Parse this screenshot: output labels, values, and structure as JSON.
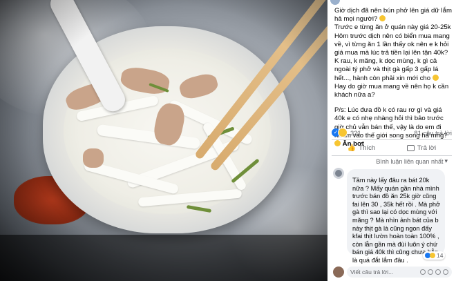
{
  "post": {
    "text_lines": [
      "Giờ dịch đã nên bún phở lên giá dữ lắm hả mọi người?",
      "Trước e từng ăn ở quán này giá 20-25k",
      "Hôm trước dịch nên có biển mua mang về, vì từng ăn 1 lần thấy ok nên e k hỏi giá mua mà lúc trả tiền lại lên tận 40k?",
      "K rau, k măng, k dọc mùng, k gì cả ngoài tý phở và thịt gà gấp 3 gấp lá hết..., hành còn phải xin mới cho",
      "Hay do giờ mua mang về nên họ k cần khách nữa a?",
      "P/s: Lúc đưa đồ k có rau rơ gì và giá 40k e có nhẹ nhàng hỏi thì bảo trước giờ chủ vẫn bán thế, vậy là do em đi nhầm vào thế giới song song hả mng?",
      "Ăn bơt"
    ],
    "reaction_count": "321",
    "comment_count": "81 câu trả lời",
    "like_label": "Thích",
    "reply_label": "Trả lời",
    "sort_label": "Bình luận liên quan nhất"
  },
  "comment": {
    "text": "Tầm này lấy đâu ra bát 20k nữa ? Mấy quán gần nhà mình trước bán đồ ăn 25k giờ cũng fai lên 30 , 35k hết rồi . Mà phở gà thì sao lại có dọc mùng với măng ? Mà nhìn ảnh bát của b này thịt gà là cũng ngon đấy kfai thịt lườn hoàn toàn 100% , còn lẫn gần mà đùi luôn ý chứ bán giá 40k thì cũng chưa hẳn là quá đắt lắm đâu .",
    "reaction_count": "14"
  },
  "reply_box": {
    "placeholder": "Viết câu trả lời..."
  },
  "icons": {
    "like": "thumbs-up-icon",
    "haha": "haha-icon",
    "comment": "comment-icon"
  },
  "colors": {
    "accent": "#1877f2",
    "text": "#050505",
    "muted": "#65676b"
  }
}
